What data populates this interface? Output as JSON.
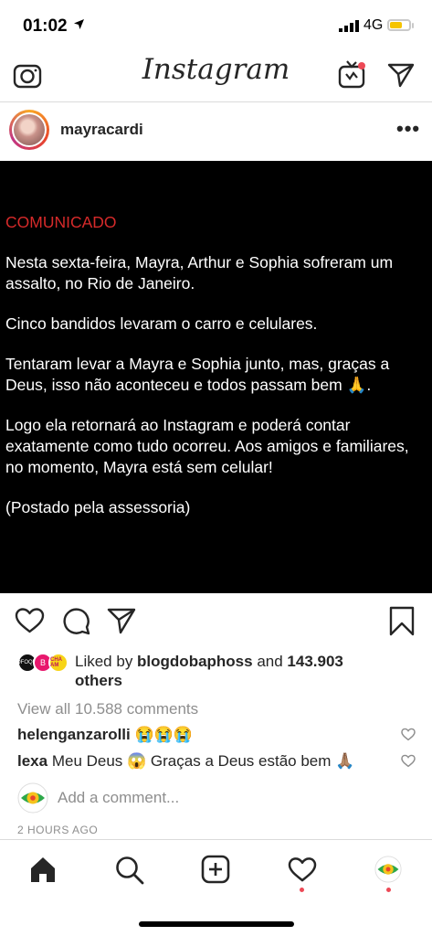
{
  "status_bar": {
    "time": "01:02",
    "network": "4G"
  },
  "header": {
    "logo": "Instagram"
  },
  "post": {
    "username": "mayracardi",
    "more": "•••",
    "image_text": {
      "title": "COMUNICADO",
      "paragraphs": [
        "Nesta sexta-feira,  Mayra, Arthur e Sophia sofreram um assalto,  no Rio de Janeiro.",
        "Cinco bandidos levaram o carro e celulares.",
        "Tentaram levar a Mayra e Sophia junto, mas, graças a Deus, isso não aconteceu  e todos passam bem 🙏.",
        "Logo ela retornará ao Instagram e poderá contar exatamente como tudo ocorreu. Aos amigos e familiares, no momento,  Mayra está sem celular!",
        "(Postado pela assessoria)"
      ]
    },
    "likes": {
      "prefix": "Liked by ",
      "user": "blogdobaphoss",
      "connector": " and ",
      "count": "143.903",
      "suffix": " others",
      "facepile": [
        "FOFOQUEI",
        "B",
        "CHA AM"
      ]
    },
    "view_all_comments": "View all 10.588 comments",
    "comments": [
      {
        "user": "helenganzarolli",
        "text": "😭😭😭"
      },
      {
        "user": "lexa",
        "text": "Meu Deus 😱 Graças a Deus estão bem 🙏🏽"
      }
    ],
    "add_comment_placeholder": "Add a comment...",
    "time_ago": "2 HOURS AGO"
  },
  "colors": {
    "accent_red": "#d62a2a",
    "notification": "#ed4956",
    "muted": "#8e8e8e"
  },
  "icons": {
    "header": [
      "camera-icon",
      "igtv-icon",
      "direct-icon"
    ],
    "actions": [
      "heart-icon",
      "comment-icon",
      "share-icon",
      "bookmark-icon"
    ],
    "tabbar": [
      "home-icon",
      "search-icon",
      "add-icon",
      "activity-icon",
      "profile-icon"
    ]
  }
}
